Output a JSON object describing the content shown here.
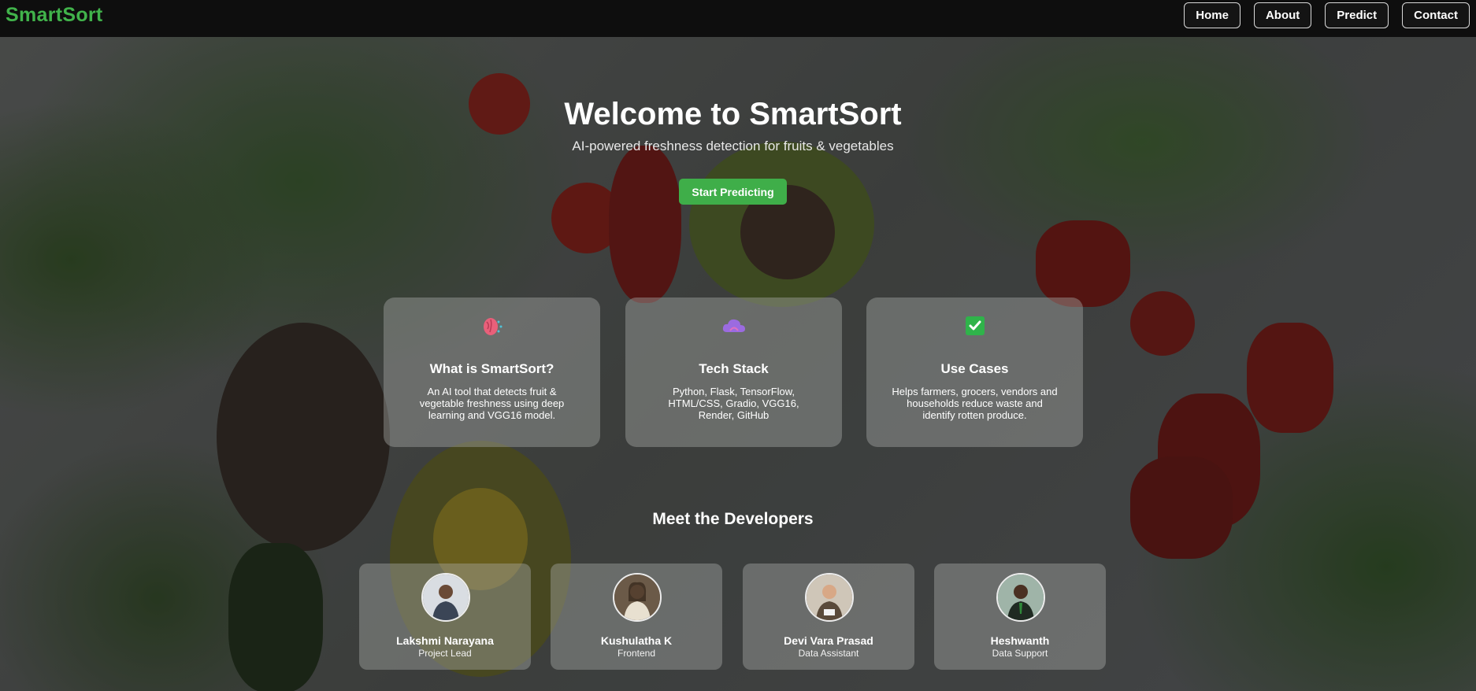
{
  "brand": "SmartSort",
  "nav": [
    "Home",
    "About",
    "Predict",
    "Contact"
  ],
  "hero": {
    "title": "Welcome to SmartSort",
    "subtitle": "AI-powered freshness detection for fruits & vegetables",
    "cta": "Start Predicting"
  },
  "cards": [
    {
      "icon": "brain-icon",
      "title": "What is SmartSort?",
      "desc": "An AI tool that detects fruit & vegetable freshness using deep learning and VGG16 model."
    },
    {
      "icon": "cloud-icon",
      "title": "Tech Stack",
      "desc": "Python, Flask, TensorFlow, HTML/CSS, Gradio, VGG16, Render, GitHub"
    },
    {
      "icon": "check-icon",
      "title": "Use Cases",
      "desc": "Helps farmers, grocers, vendors and households reduce waste and identify rotten produce."
    }
  ],
  "team_title": "Meet the Developers",
  "developers": [
    {
      "name": "Lakshmi Narayana",
      "role": "Project Lead"
    },
    {
      "name": "Kushulatha K",
      "role": "Frontend"
    },
    {
      "name": "Devi Vara Prasad",
      "role": "Data Assistant"
    },
    {
      "name": "Heshwanth",
      "role": "Data Support"
    }
  ],
  "colors": {
    "accent": "#3fae49",
    "brand": "#41b34b",
    "topbar": "#0e0e0e"
  }
}
